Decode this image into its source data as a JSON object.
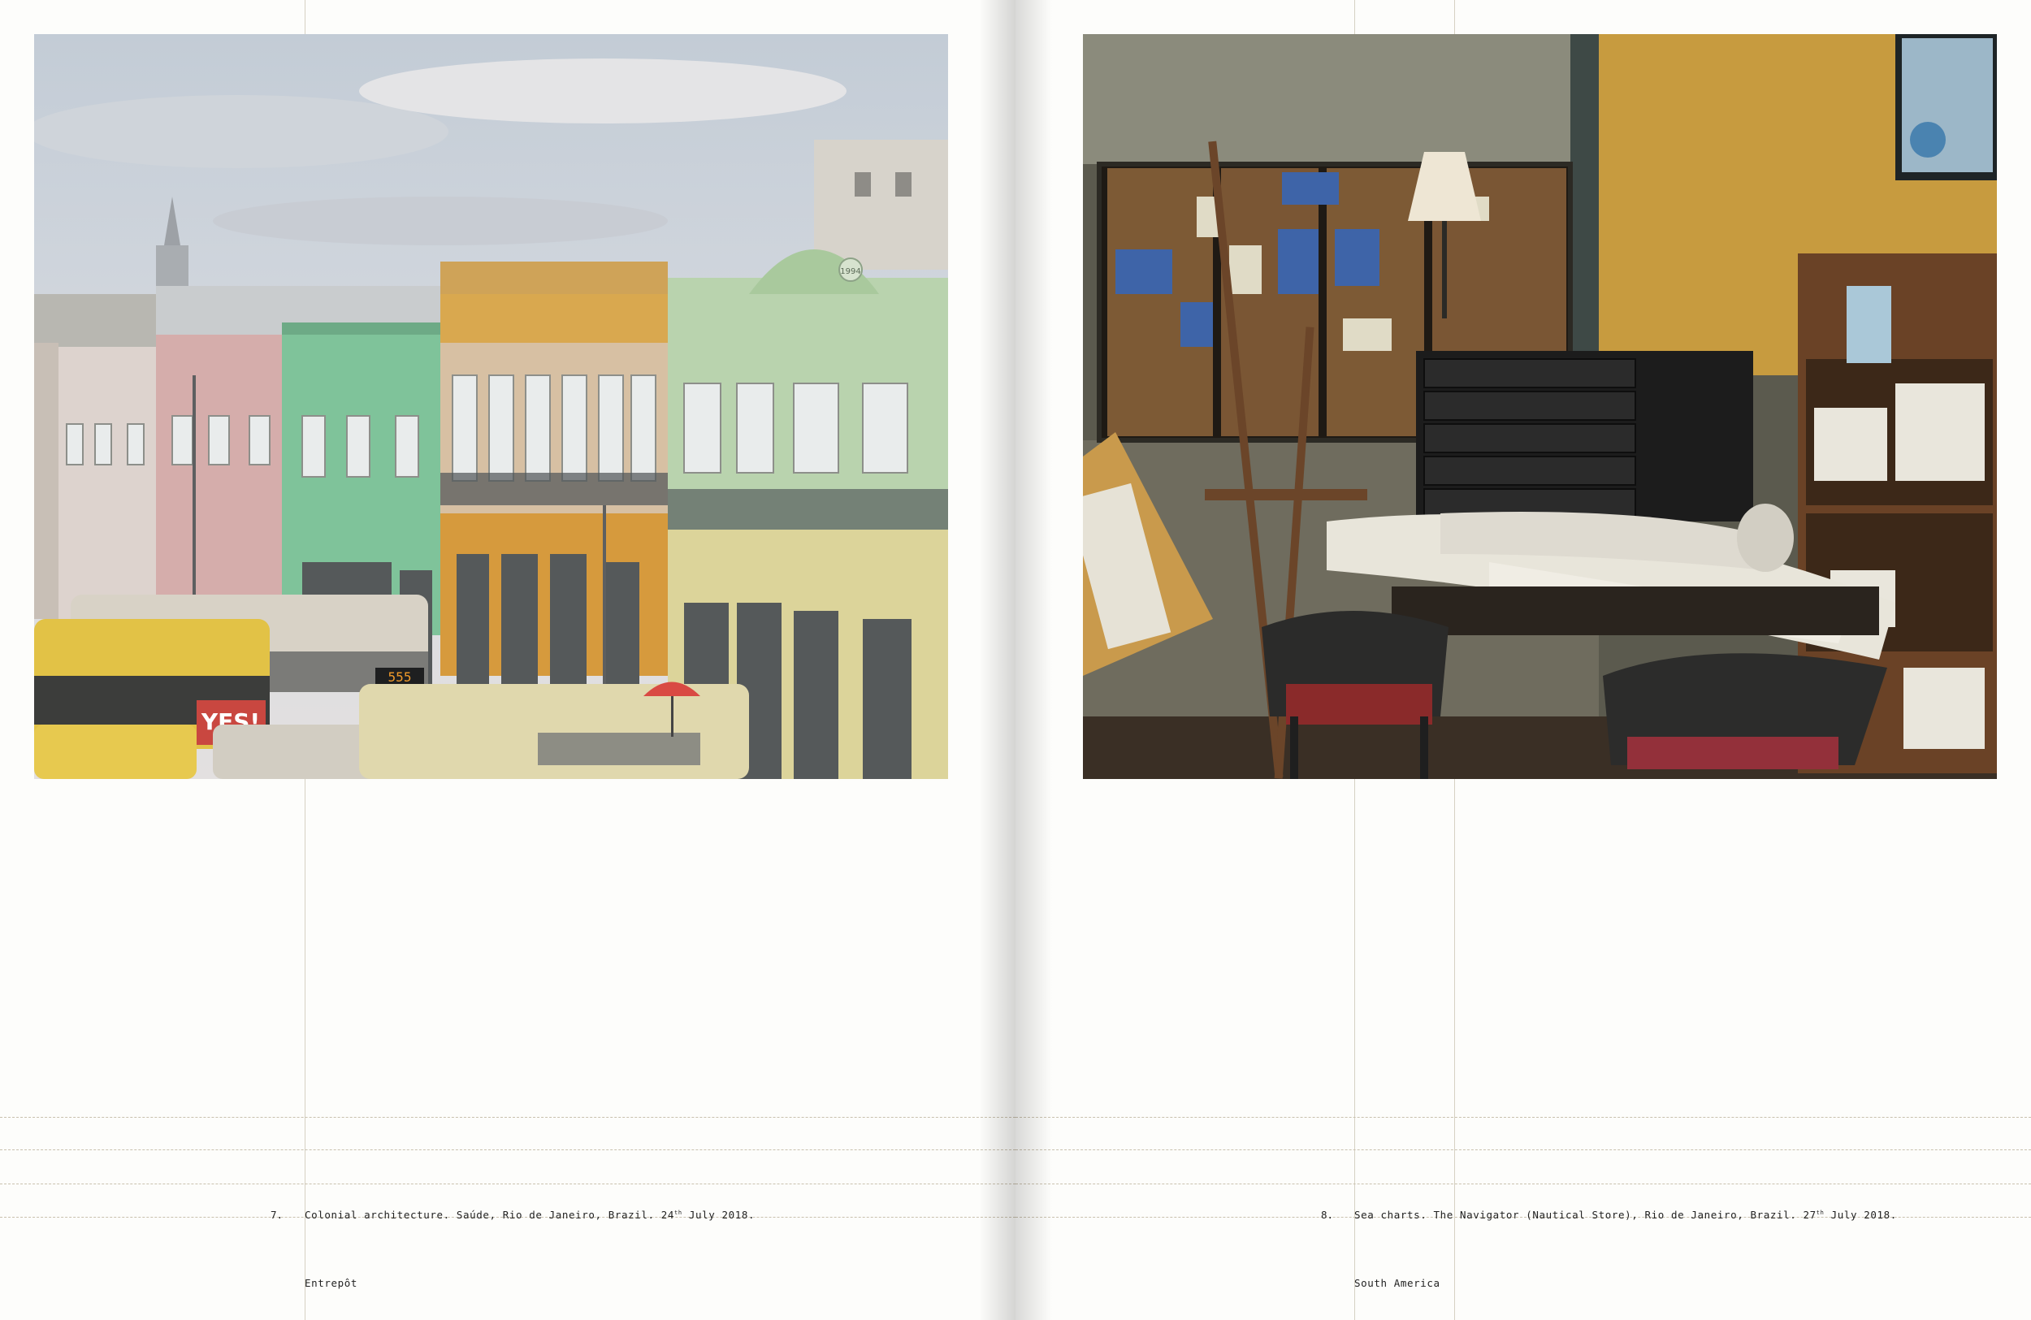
{
  "left_page": {
    "plate_number": "7.",
    "caption_before_sup": "Colonial architecture. Saúde, Rio de Janeiro, Brazil. 24",
    "caption_sup": "th",
    "caption_after_sup": " July 2018.",
    "footer": "Entrepôt"
  },
  "right_page": {
    "plate_number": "8.",
    "caption_before_sup": "Sea charts. The Navigator (Nautical Store), Rio de Janeiro, Brazil. 27",
    "caption_sup": "th",
    "caption_after_sup": " July 2018.",
    "footer": "South America"
  },
  "photo_left": {
    "shop_sign": "YES!",
    "bus_display": "555",
    "facade_year": "1994"
  },
  "colors": {
    "paper": "#fdfdfb",
    "guide_line": "#d6d1c3",
    "text": "#222222"
  }
}
